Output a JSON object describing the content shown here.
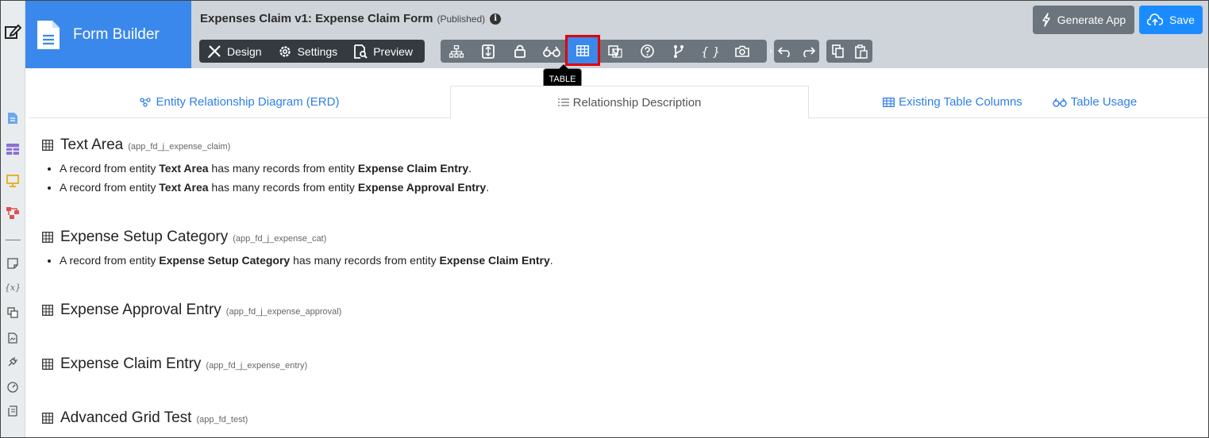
{
  "app": {
    "brand": "Form Builder",
    "title": "Expenses Claim v1: Expense Claim Form",
    "status": "(Published)",
    "info_icon": "i"
  },
  "modes": [
    {
      "label": "Design",
      "icon": "design-icon"
    },
    {
      "label": "Settings",
      "icon": "gear-icon"
    },
    {
      "label": "Preview",
      "icon": "preview-icon"
    }
  ],
  "toolbar": {
    "active_tool": "table",
    "tooltip": "TABLE",
    "tools": [
      "hierarchy-icon",
      "export-icon",
      "lock-icon",
      "binoculars-icon",
      "table-icon",
      "translate-icon",
      "help-icon",
      "branch-icon",
      "braces-icon",
      "camera-icon"
    ],
    "braces_glyph": "{ }"
  },
  "actions": {
    "generate": "Generate App",
    "save": "Save"
  },
  "tabs": [
    {
      "label": "Entity Relationship Diagram (ERD)",
      "active": false
    },
    {
      "label": "Relationship Description",
      "active": true
    },
    {
      "label": "Existing Table Columns",
      "active": false
    },
    {
      "label": "Table Usage",
      "active": false
    }
  ],
  "sections": [
    {
      "name": "Text Area",
      "table": "(app_fd_j_expense_claim)",
      "relations": [
        {
          "pre": "A record from entity ",
          "from": "Text Area",
          "mid": " has many records from entity ",
          "to": "Expense Claim Entry",
          "end": "."
        },
        {
          "pre": "A record from entity ",
          "from": "Text Area",
          "mid": " has many records from entity ",
          "to": "Expense Approval Entry",
          "end": "."
        }
      ]
    },
    {
      "name": "Expense Setup Category",
      "table": "(app_fd_j_expense_cat)",
      "relations": [
        {
          "pre": "A record from entity ",
          "from": "Expense Setup Category",
          "mid": " has many records from entity ",
          "to": "Expense Claim Entry",
          "end": "."
        }
      ]
    },
    {
      "name": "Expense Approval Entry",
      "table": "(app_fd_j_expense_approval)",
      "relations": []
    },
    {
      "name": "Expense Claim Entry",
      "table": "(app_fd_j_expense_entry)",
      "relations": []
    },
    {
      "name": "Advanced Grid Test",
      "table": "(app_fd_test)",
      "relations": []
    }
  ],
  "rail": {
    "variable_glyph": "{x}"
  }
}
